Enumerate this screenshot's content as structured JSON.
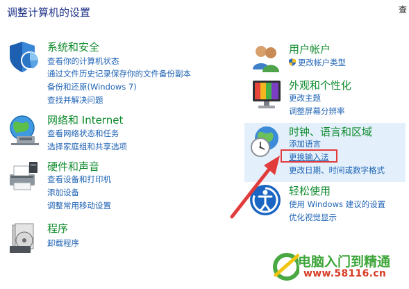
{
  "page": {
    "title": "调整计算机的设置",
    "view_by": "查"
  },
  "categories": {
    "system": {
      "title": "系统和安全",
      "links": [
        "查看你的计算机状态",
        "通过文件历史记录保存你的文件备份副本",
        "备份和还原(Windows 7)",
        "查找并解决问题"
      ]
    },
    "network": {
      "title": "网络和 Internet",
      "links": [
        "查看网络状态和任务",
        "选择家庭组和共享选项"
      ]
    },
    "hardware": {
      "title": "硬件和声音",
      "links": [
        "查看设备和打印机",
        "添加设备",
        "调整常用移动设置"
      ]
    },
    "programs": {
      "title": "程序",
      "links": [
        "卸载程序"
      ]
    },
    "users": {
      "title": "用户帐户",
      "links": [
        "更改帐户类型"
      ]
    },
    "appearance": {
      "title": "外观和个性化",
      "links": [
        "更改主题",
        "调整屏幕分辨率"
      ]
    },
    "clock": {
      "title": "时钟、语言和区域",
      "links": [
        "添加语言",
        "更换输入法",
        "更改日期、时间或数字格式"
      ]
    },
    "ease": {
      "title": "轻松使用",
      "links": [
        "使用 Windows 建议的设置",
        "优化视觉显示"
      ]
    }
  },
  "watermark": {
    "line1": "电脑入门到精通",
    "line2": "www.58116.cn"
  },
  "colors": {
    "title_green": "#0d8a2c",
    "link_blue": "#1f63b5",
    "heading_blue": "#1e3287",
    "highlight_bg": "#e3f0fb",
    "annotation_red": "#e23b3b"
  }
}
